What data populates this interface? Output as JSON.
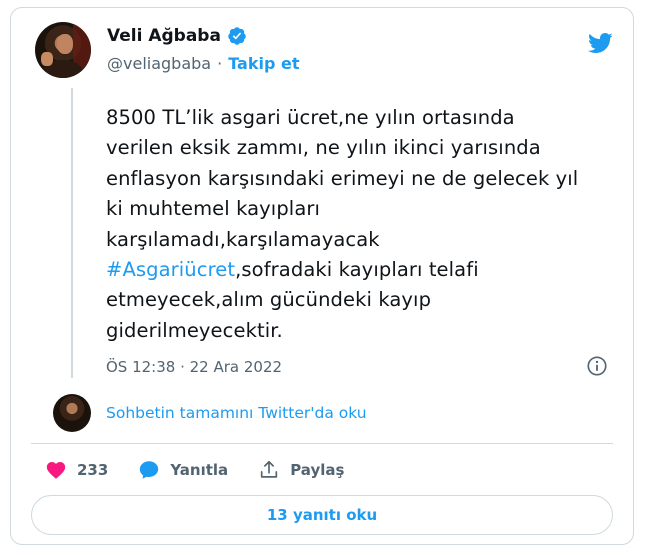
{
  "author": {
    "name": "Veli Ağbaba",
    "handle": "@veliagbaba",
    "separator": "·",
    "follow_label": "Takip et"
  },
  "tweet": {
    "text_before_hashtag": "8500 TL’lik asgari ücret,ne yılın ortasında\nverilen eksik zammı, ne yılın ikinci yarısında\nenflasyon karşısındaki erimeyi ne de gelecek yıl\nki muhtemel kayıpları\nkarşılamadı,karşılamayacak\n",
    "hashtag": "#Asgariücret",
    "text_after_hashtag": ",sofradaki kayıpları telafi\netmeyecek,alım gücündeki kayıp\ngiderilmeyecektir.",
    "timestamp": "ÖS 12:38 · 22 Ara 2022"
  },
  "conversation": {
    "link_label": "Sohbetin tamamını Twitter'da oku"
  },
  "actions": {
    "like_count": "233",
    "reply_label": "Yanıtla",
    "share_label": "Paylaş"
  },
  "read_replies_label": "13 yanıtı oku",
  "colors": {
    "accent": "#1d9bf0",
    "like": "#f91880",
    "text": "#0f1419",
    "secondary": "#536471",
    "border": "#cfd9de"
  },
  "icons": [
    "verified-badge-icon",
    "twitter-bird-icon",
    "info-icon",
    "heart-icon",
    "reply-bubble-icon",
    "share-icon"
  ]
}
